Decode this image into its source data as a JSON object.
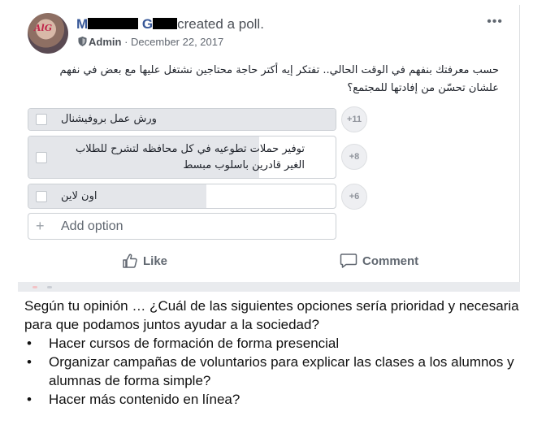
{
  "post": {
    "author_first": "M",
    "author_last": "G",
    "action_text": "created a poll.",
    "role": "Admin",
    "separator": "·",
    "date": "December 22, 2017",
    "more": "•••",
    "question": "حسب معرفتك بنفهم في الوقت الحالي.. تفتكر إيه أكتر حاجة محتاجين نشتغل عليها مع بعض في نفهم علشان تحسّن من إفادتها للمجتمع؟"
  },
  "poll": {
    "options": [
      {
        "label": "ورش عمل بروفيشنال",
        "count": "+11",
        "fill": 1.0
      },
      {
        "label": "توفير حملات تطوعيه في كل محافظه لتشرح للطلاب الغير قادرين باسلوب مبسط",
        "count": "+8",
        "fill": 0.75
      },
      {
        "label": "اون لاين",
        "count": "+6",
        "fill": 0.58
      }
    ],
    "add_option_placeholder": "Add option",
    "add_option_icon": "+"
  },
  "actions": {
    "like_label": "Like",
    "comment_label": "Comment"
  },
  "caption": {
    "intro": "Según  tu opinión … ¿Cuál de las siguientes opciones sería prioridad y necesaria para que podamos juntos ayudar a la sociedad?",
    "bullets": [
      "Hacer cursos de formación de forma presencial",
      "Organizar campañas de voluntarios para explicar las clases a los alumnos y alumnas de forma simple?",
      "Hacer más contenido en línea?"
    ]
  },
  "colors": {
    "link": "#385898",
    "fill": "#e4e6ea",
    "text": "#1d2129"
  }
}
